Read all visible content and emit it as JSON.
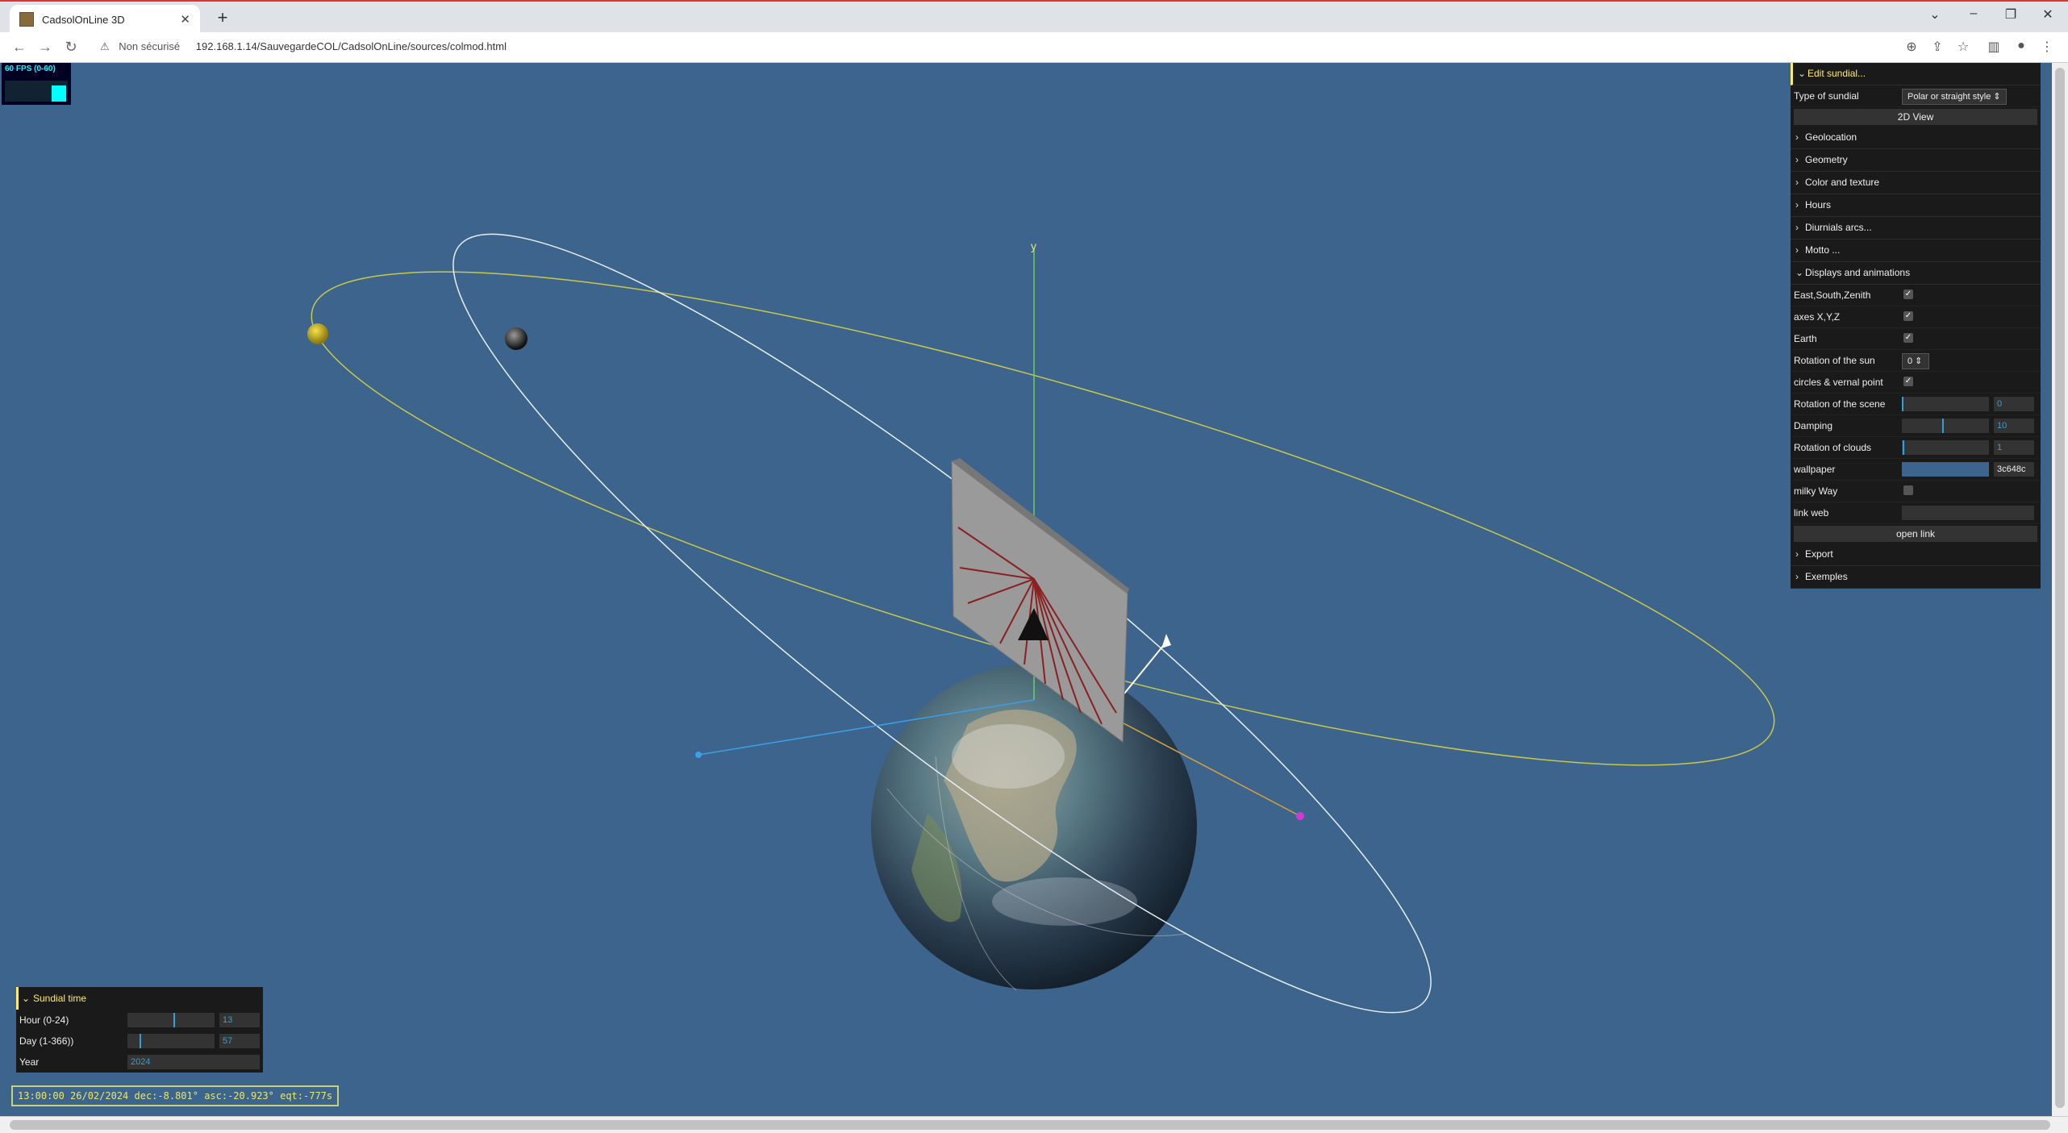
{
  "browser": {
    "tab_title": "CadsolOnLine 3D",
    "tab_close": "✕",
    "new_tab": "+",
    "security_label": "Non sécurisé",
    "url": "192.168.1.14/SauvegardeCOL/CadsolOnLine/sources/colmod.html"
  },
  "fps": {
    "label": "60 FPS (0-60)"
  },
  "scene": {
    "axis_label": "y"
  },
  "gui": {
    "edit_label": "Edit sundial...",
    "type_label": "Type of sundial",
    "type_value": "Polar or straight style ⇕",
    "view2d_label": "2D View",
    "folders": {
      "geolocation": "Geolocation",
      "geometry": "Geometry",
      "color": "Color and texture",
      "hours": "Hours",
      "diurnals": "Diurnials arcs...",
      "motto": "Motto ...",
      "displays": "Displays and animations",
      "export": "Export",
      "exemples": "Exemples"
    },
    "displays": {
      "esz_label": "East,South,Zenith",
      "axes_label": "axes X,Y,Z",
      "earth_label": "Earth",
      "sunrot_label": "Rotation of the sun",
      "sunrot_value": "0 ⇕",
      "circles_label": "circles & vernal point",
      "scenerot_label": "Rotation of the scene",
      "scenerot_value": "0",
      "damping_label": "Damping",
      "damping_value": "10",
      "clouds_label": "Rotation of clouds",
      "clouds_value": "1",
      "wallpaper_label": "wallpaper",
      "wallpaper_value": "3c648c",
      "milky_label": "milky Way",
      "link_label": "link web",
      "openlink_label": "open link"
    }
  },
  "sundial_time": {
    "title": "Sundial time",
    "hour_label": "Hour  (0-24)",
    "hour_value": "13",
    "day_label": "Day (1-366))",
    "day_value": "57",
    "year_label": "Year",
    "year_value": "2024"
  },
  "status_line": "13:00:00 26/02/2024 dec:-8.801° asc:-20.923° eqt:-777s",
  "colors": {
    "background": "#3c648c",
    "ecliptic": "#c8c84a",
    "equator": "#e8eef4",
    "gui_bg": "#1a1a1a",
    "gui_accent": "#2fa1d6",
    "gui_title": "#ffeb6b"
  }
}
